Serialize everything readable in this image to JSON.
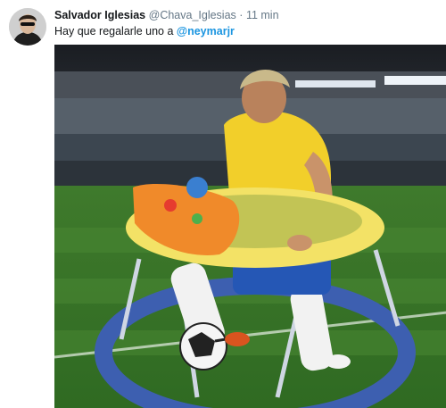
{
  "tweet": {
    "author_name": "Salvador Iglesias",
    "author_handle": "@Chava_Iglesias",
    "separator": "·",
    "timestamp": "11 min",
    "text_prefix": "Hay que regalarle uno a ",
    "mention": "@neymarjr"
  },
  "colors": {
    "name_text": "#14171a",
    "secondary_text": "#657786",
    "mention": "#1b95e0"
  },
  "media": {
    "icon": "photo-meme-player-in-baby-walker"
  }
}
